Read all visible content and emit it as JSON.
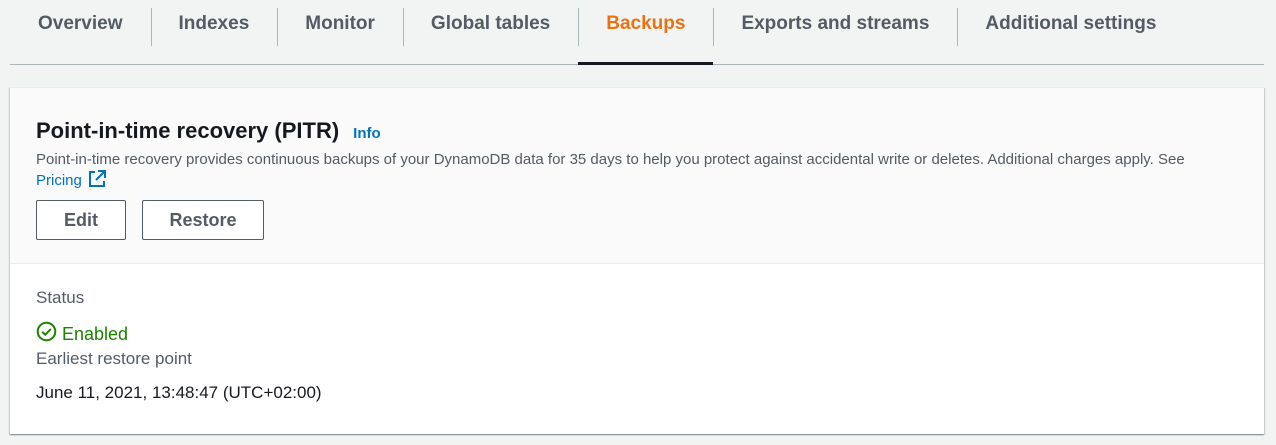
{
  "tabs": [
    {
      "label": "Overview",
      "active": false
    },
    {
      "label": "Indexes",
      "active": false
    },
    {
      "label": "Monitor",
      "active": false
    },
    {
      "label": "Global tables",
      "active": false
    },
    {
      "label": "Backups",
      "active": true
    },
    {
      "label": "Exports and streams",
      "active": false
    },
    {
      "label": "Additional settings",
      "active": false
    }
  ],
  "pitr": {
    "title": "Point-in-time recovery (PITR)",
    "info_label": "Info",
    "description": "Point-in-time recovery provides continuous backups of your DynamoDB data for 35 days to help you protect against accidental write or deletes. Additional charges apply. See ",
    "pricing_label": "Pricing",
    "external_icon": "external-link-icon",
    "edit_label": "Edit",
    "restore_label": "Restore"
  },
  "details": {
    "status_label": "Status",
    "status_value": "Enabled",
    "status_icon": "check-circle-icon",
    "earliest_label": "Earliest restore point",
    "earliest_value": "June 11, 2021, 13:48:47 (UTC+02:00)"
  },
  "colors": {
    "active_tab": "#ec7211",
    "link": "#0073bb",
    "success": "#1d8102"
  }
}
